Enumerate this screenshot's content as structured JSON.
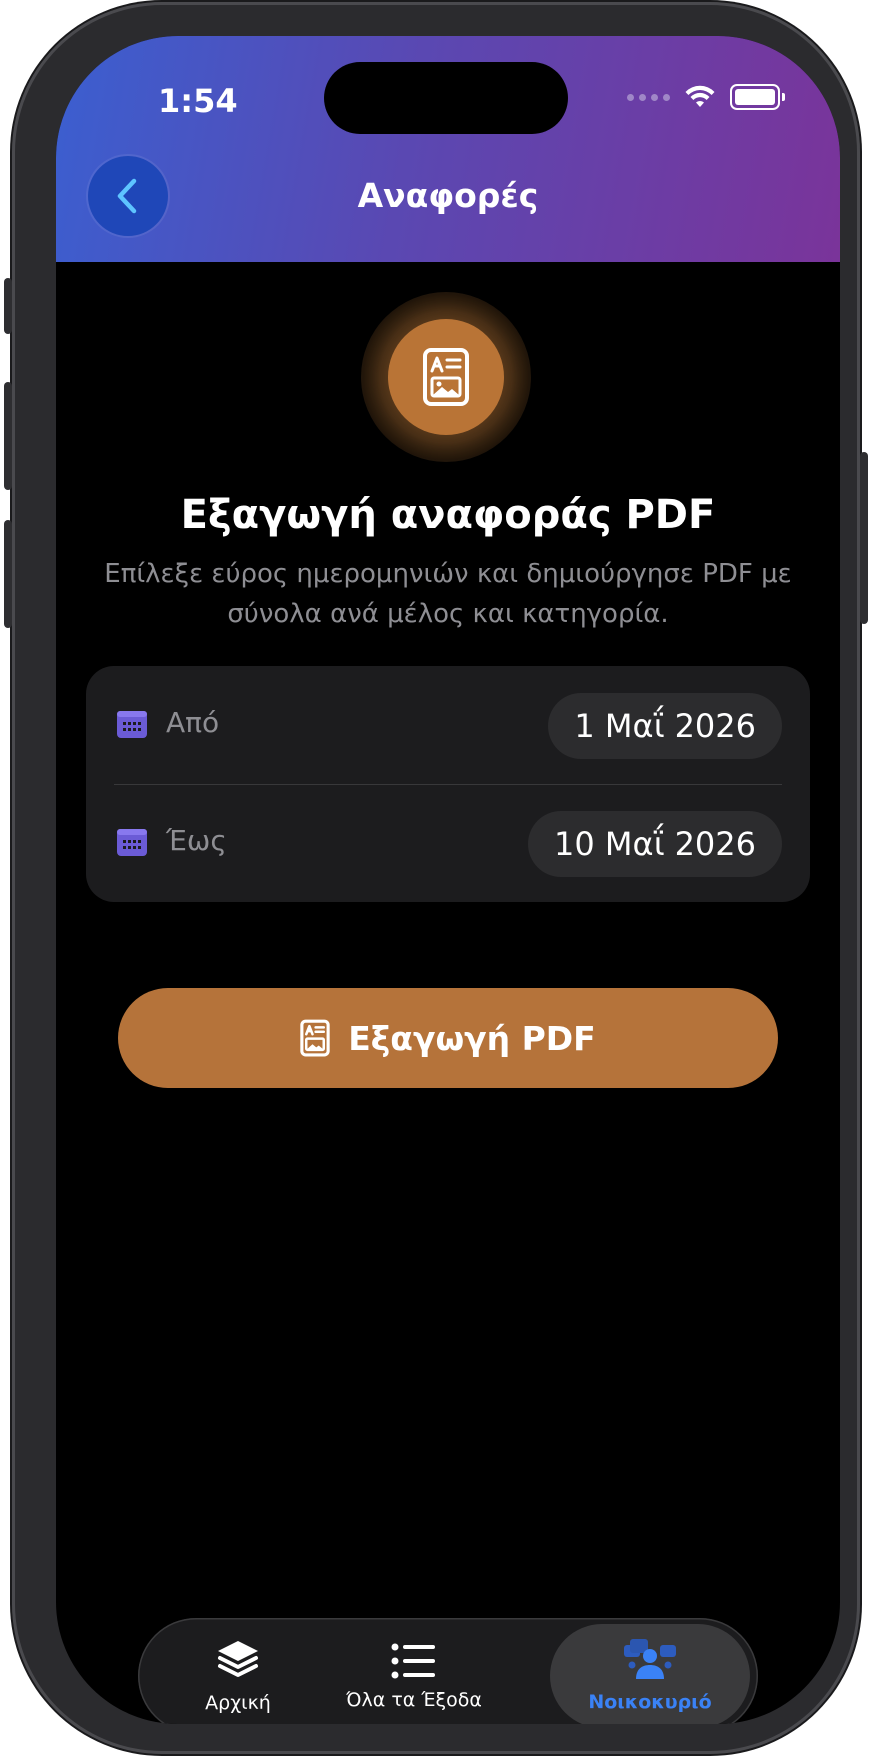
{
  "status_bar": {
    "time": "1:54"
  },
  "nav": {
    "title": "Αναφορές"
  },
  "hero": {
    "title": "Εξαγωγή αναφοράς PDF",
    "subtitle": "Επίλεξε εύρος ημερομηνιών και δημιούργησε PDF με σύνολα ανά μέλος και κατηγορία."
  },
  "date_range": {
    "from_label": "Από",
    "from_value": "1 Μαΐ 2026",
    "to_label": "Έως",
    "to_value": "10 Μαΐ 2026"
  },
  "export_button": {
    "label": "Εξαγωγή PDF"
  },
  "tabs": [
    {
      "label": "Αρχική",
      "icon": "layers-icon",
      "active": false
    },
    {
      "label": "Όλα τα Έξοδα",
      "icon": "list-icon",
      "active": false
    },
    {
      "label": "Νοικοκυριό",
      "icon": "household-icon",
      "active": true
    }
  ],
  "colors": {
    "accent_orange": "#b5733a",
    "header_gradient_start": "#3b5fd0",
    "header_gradient_end": "#7a349a",
    "tab_active": "#3a82f6",
    "calendar_icon": "#6b5bd6"
  }
}
